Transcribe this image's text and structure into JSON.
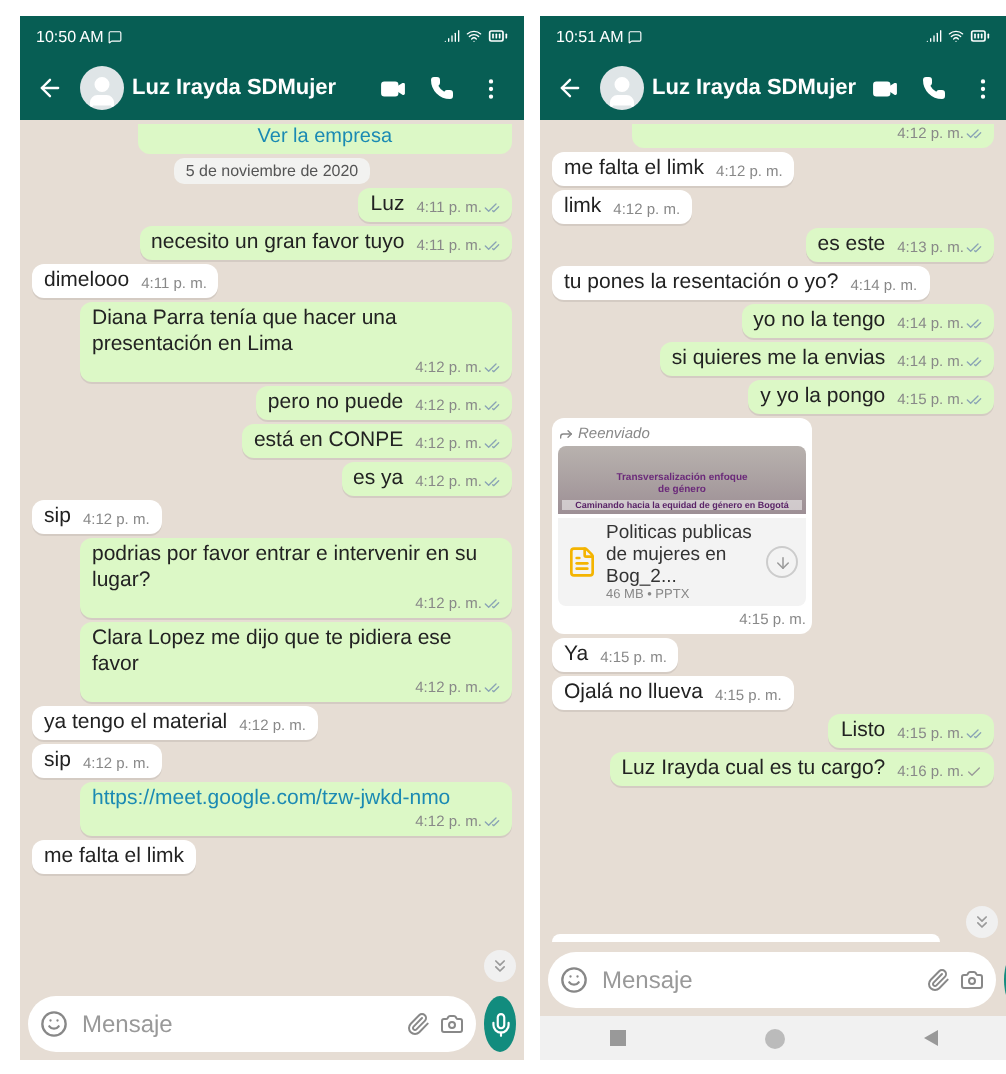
{
  "phones": [
    {
      "status_time": "10:50 AM",
      "contact": "Luz Irayda SDMujer",
      "input_placeholder": "Mensaje",
      "nav_bar": false,
      "messages": [
        {
          "kind": "business",
          "text": "Ver la empresa"
        },
        {
          "kind": "date",
          "text": "5 de noviembre de 2020"
        },
        {
          "kind": "out",
          "text": "Luz",
          "time": "4:11 p. m.",
          "read": true
        },
        {
          "kind": "out",
          "text": "necesito un gran favor tuyo",
          "time": "4:11 p. m.",
          "read": true
        },
        {
          "kind": "in",
          "text": "dimelooo",
          "time": "4:11 p. m."
        },
        {
          "kind": "out",
          "text": "Diana Parra tenía que hacer una presentación en Lima",
          "time": "4:12 p. m.",
          "read": true
        },
        {
          "kind": "out",
          "text": "pero no puede",
          "time": "4:12 p. m.",
          "read": true
        },
        {
          "kind": "out",
          "text": "está en CONPE",
          "time": "4:12 p. m.",
          "read": true
        },
        {
          "kind": "out",
          "text": "es ya",
          "time": "4:12 p. m.",
          "read": true
        },
        {
          "kind": "in",
          "text": "sip",
          "time": "4:12 p. m."
        },
        {
          "kind": "out",
          "text": "podrias por favor entrar e intervenir en su lugar?",
          "time": "4:12 p. m.",
          "read": true
        },
        {
          "kind": "out",
          "text": "Clara Lopez me dijo que te pidiera ese favor",
          "time": "4:12 p. m.",
          "read": true
        },
        {
          "kind": "in",
          "text": "ya tengo el material",
          "time": "4:12 p. m."
        },
        {
          "kind": "in",
          "text": "sip",
          "time": "4:12 p. m."
        },
        {
          "kind": "link",
          "text": "https://meet.google.com/tzw-jwkd-nmo",
          "time": "4:12 p. m.",
          "read": true
        },
        {
          "kind": "in",
          "text": "me falta el limk"
        }
      ]
    },
    {
      "status_time": "10:51 AM",
      "contact": "Luz Irayda SDMujer",
      "input_placeholder": "Mensaje",
      "nav_bar": true,
      "messages": [
        {
          "kind": "time_only",
          "time": "4:12 p. m.",
          "read": true
        },
        {
          "kind": "in",
          "text": "me falta el limk",
          "time": "4:12 p. m."
        },
        {
          "kind": "in",
          "text": "limk",
          "time": "4:12 p. m."
        },
        {
          "kind": "out",
          "text": "es este",
          "time": "4:13 p. m.",
          "read": true
        },
        {
          "kind": "in",
          "text": "tu pones la resentación o yo?",
          "time": "4:14 p. m."
        },
        {
          "kind": "out",
          "text": "yo no la tengo",
          "time": "4:14 p. m.",
          "read": true
        },
        {
          "kind": "out",
          "text": "si quieres me la envias",
          "time": "4:14 p. m.",
          "read": true
        },
        {
          "kind": "out",
          "text": "y yo la pongo",
          "time": "4:15 p. m.",
          "read": true
        },
        {
          "kind": "document",
          "forwarded": "Reenviado",
          "preview_title": "Transversalización enfoque de género",
          "preview_subtitle": "Caminando hacia la equidad de género en Bogotá",
          "file_name": "Politicas publicas de mujeres en Bog_2...",
          "file_meta": "46 MB • PPTX",
          "time": "4:15 p. m."
        },
        {
          "kind": "in",
          "text": "Ya",
          "time": "4:15 p. m."
        },
        {
          "kind": "in",
          "text": "Ojalá no llueva",
          "time": "4:15 p. m."
        },
        {
          "kind": "out",
          "text": "Listo",
          "time": "4:15 p. m.",
          "read": true
        },
        {
          "kind": "out",
          "text": "Luz Irayda cual es tu cargo?",
          "time": "4:16 p. m.",
          "read": false
        },
        {
          "kind": "cut"
        }
      ]
    }
  ]
}
